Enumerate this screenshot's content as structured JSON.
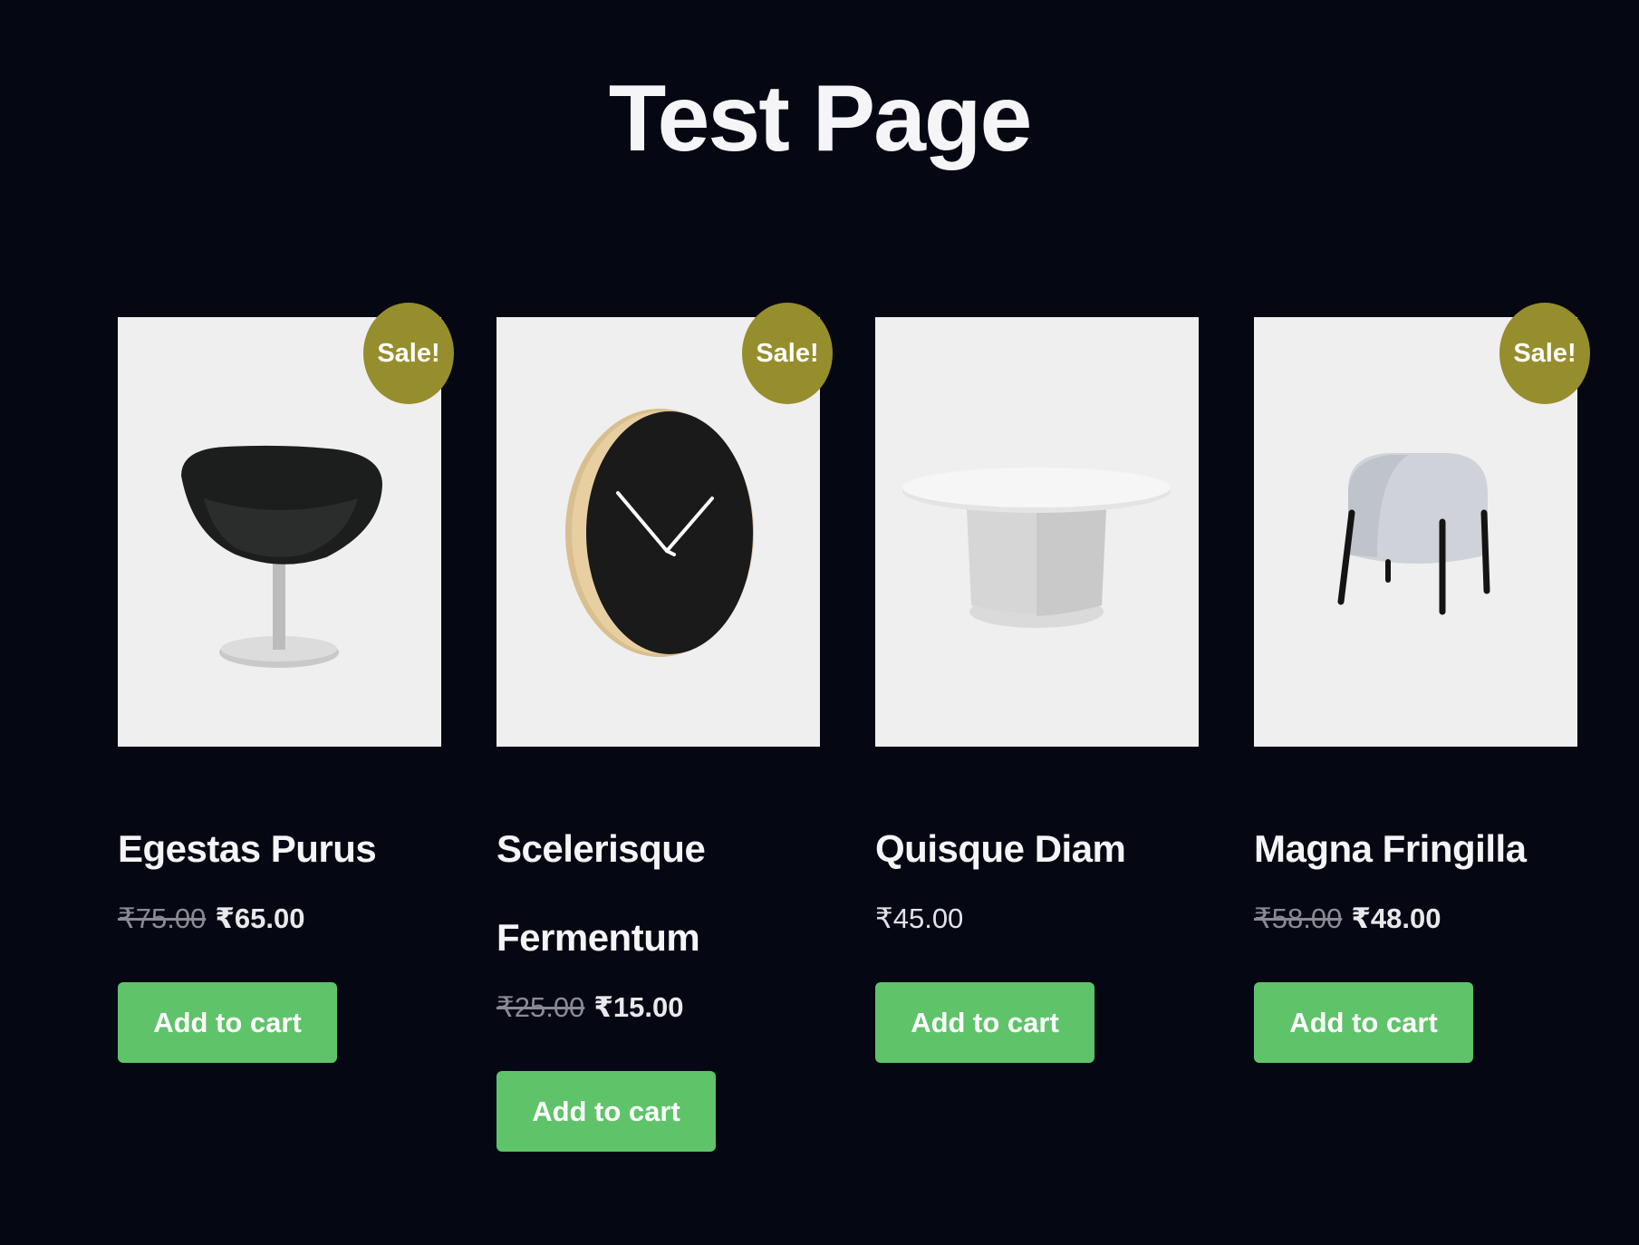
{
  "page": {
    "title": "Test Page"
  },
  "products": [
    {
      "name": "Egestas Purus",
      "badge": "Sale!",
      "regular_price": "₹75.00",
      "sale_price": "₹65.00",
      "button_label": "Add to cart",
      "image": "swivel-chair"
    },
    {
      "name": "Scelerisque Fermentum",
      "badge": "Sale!",
      "regular_price": "₹25.00",
      "sale_price": "₹15.00",
      "button_label": "Add to cart",
      "image": "wall-clock"
    },
    {
      "name": "Quisque Diam",
      "price": "₹45.00",
      "button_label": "Add to cart",
      "image": "coffee-table"
    },
    {
      "name": "Magna Fringilla",
      "badge": "Sale!",
      "regular_price": "₹58.00",
      "sale_price": "₹48.00",
      "button_label": "Add to cart",
      "image": "pouf-stool"
    }
  ],
  "colors": {
    "background": "#050713",
    "sale_badge": "#968d2c",
    "button": "#5fc36a",
    "image_background": "#efefef"
  }
}
